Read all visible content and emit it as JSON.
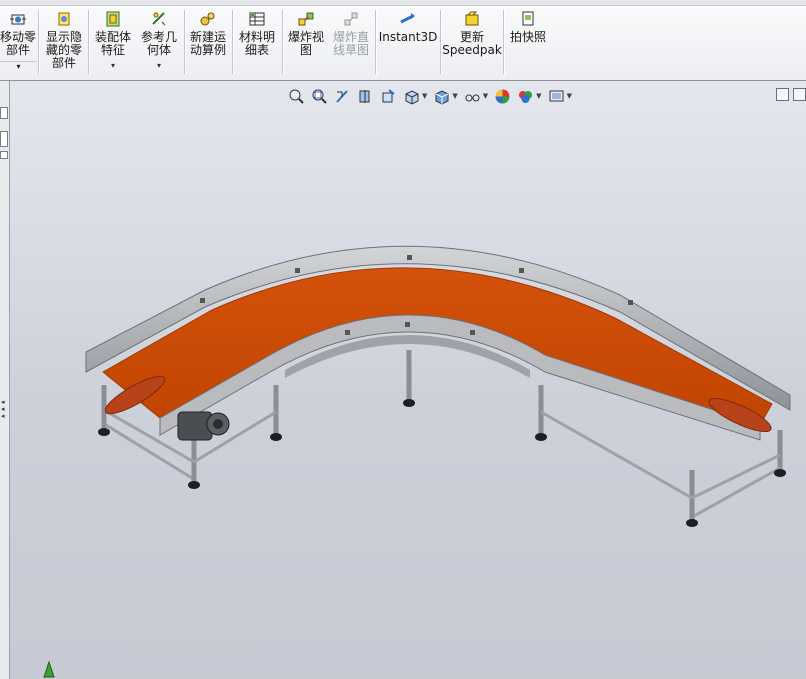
{
  "ribbon": {
    "items": [
      {
        "id": "move-component",
        "label": "移动零\n部件",
        "icon": "move-component-icon",
        "enabled": true
      },
      {
        "id": "show-hidden",
        "label": "显示隐\n藏的零\n部件",
        "icon": "show-hidden-components-icon",
        "enabled": true
      },
      {
        "id": "assembly-features",
        "label": "装配体\n特征",
        "icon": "assembly-features-icon",
        "enabled": true
      },
      {
        "id": "reference-geometry",
        "label": "参考几\n何体",
        "icon": "reference-geometry-icon",
        "enabled": true
      },
      {
        "id": "new-motion-study",
        "label": "新建运\n动算例",
        "icon": "motion-study-icon",
        "enabled": true
      },
      {
        "id": "bill-of-materials",
        "label": "材料明\n细表",
        "icon": "bom-table-icon",
        "enabled": true
      },
      {
        "id": "exploded-view",
        "label": "爆炸视\n图",
        "icon": "exploded-view-icon",
        "enabled": true
      },
      {
        "id": "explode-line-sketch",
        "label": "爆炸直\n线草图",
        "icon": "explode-line-sketch-icon",
        "enabled": false
      },
      {
        "id": "instant3d",
        "label": "Instant3D",
        "icon": "instant3d-icon",
        "enabled": true
      },
      {
        "id": "update-speedpak",
        "label": "更新\nSpeedpak",
        "icon": "speedpak-icon",
        "enabled": true
      },
      {
        "id": "snapshot",
        "label": "拍快照",
        "icon": "snapshot-icon",
        "enabled": true
      }
    ]
  },
  "view_toolbar": {
    "icons": [
      "zoom-to-fit-icon",
      "zoom-to-area-icon",
      "previous-view-icon",
      "section-view-icon",
      "dynamic-annotation-icon",
      "view-orientation-icon",
      "display-style-icon",
      "hide-show-items-icon",
      "edit-appearance-icon",
      "apply-scene-icon",
      "view-settings-icon"
    ]
  },
  "colors": {
    "belt": "#cc4a00",
    "belt_edge": "#a53a00",
    "frame": "#b4b6ba",
    "frame_dark": "#7d8085",
    "leg": "#9a9da2",
    "motor": "#4a4d52",
    "viewport_top": "#e4e7ee",
    "viewport_bottom": "#c6cad3"
  }
}
